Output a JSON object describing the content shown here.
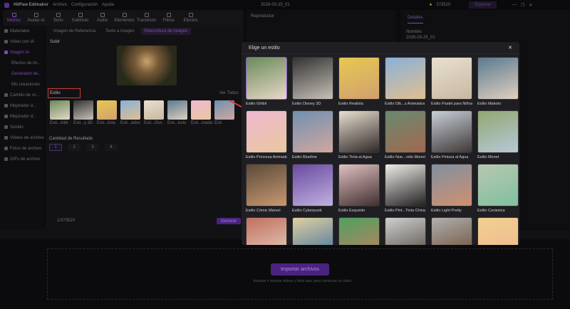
{
  "app": {
    "title": "HitPaw Edimakor",
    "menu": [
      "Archivo",
      "Configuración",
      "Ayuda"
    ],
    "project": "2026-03-25_01",
    "credits": "373520",
    "export": "Exportar"
  },
  "toolbar": [
    {
      "label": "Medios",
      "active": true
    },
    {
      "label": "Avatar AI"
    },
    {
      "label": "Texto"
    },
    {
      "label": "Subtítulo"
    },
    {
      "label": "Audio"
    },
    {
      "label": "Elementos"
    },
    {
      "label": "Transición"
    },
    {
      "label": "Filtros"
    },
    {
      "label": "Efectos"
    }
  ],
  "sidebar": [
    {
      "label": "Materiales"
    },
    {
      "label": "Video con IA"
    },
    {
      "label": "Imagen IA",
      "active": true
    },
    {
      "label": "Efectos de im...",
      "sub": true
    },
    {
      "label": "Generador de...",
      "sub": true,
      "active": true
    },
    {
      "label": "Mis creaciones",
      "sub": true
    },
    {
      "label": "Cambio de ro..."
    },
    {
      "label": "Mejorador d..."
    },
    {
      "label": "Mejorador d..."
    },
    {
      "label": "Sonido"
    },
    {
      "label": "Videos de archivo"
    },
    {
      "label": "Fotos de archivo"
    },
    {
      "label": "GIFs de archivo"
    }
  ],
  "main": {
    "tabs": [
      "Imagen de Referencia",
      "Texto a imagen",
      "Reescritura de imagen"
    ],
    "upload_label": "Subir",
    "style_label": "Estilo",
    "see_all": "Ver Todos",
    "thumbs": [
      "Esti...hibli",
      "Esti...y 3D",
      "Esti...lista",
      "Esti...ados",
      "Esti...iños",
      "Esti...koto",
      "Esti...mada",
      "Esti"
    ],
    "qty_label": "Cantidad de Resultado",
    "qty": [
      "1",
      "2",
      "3",
      "4"
    ],
    "credits": "1/373520",
    "generate": "Generar"
  },
  "player": {
    "title": "Reproductor"
  },
  "details": {
    "tab": "Detalles",
    "name_label": "Nombre:",
    "name": "2026-03-25_01"
  },
  "modal": {
    "title": "Elige un estilo",
    "styles": [
      "Estilo Ghibli",
      "Estilo Disney 3D",
      "Estilo Realista",
      "Estilo Dib...s Animados",
      "Estilo Pastel para Niños",
      "Estilo Makoto",
      "Estilo Princesa Animada",
      "Estilo Bluefine",
      "Estilo Tinta al Agua",
      "Estilo Nue...rolio Monet",
      "Estilo Pintura al Agua",
      "Estilo Monet",
      "Estilo Cómic Marvel",
      "Estilo Cyberpunk",
      "Estilo Exquisito",
      "Estilo Pint...Tinta China",
      "Estilo Light Pretty",
      "Estilo Cerámica",
      "",
      "",
      "",
      "",
      "",
      ""
    ]
  },
  "timeline": {
    "import": "Importar archivos",
    "hint": "Arrastre o importe videos y fotos aquí para comenzar su video."
  },
  "colors": {
    "accent": "#7b4bb0",
    "highlight": "#d23a3a"
  }
}
